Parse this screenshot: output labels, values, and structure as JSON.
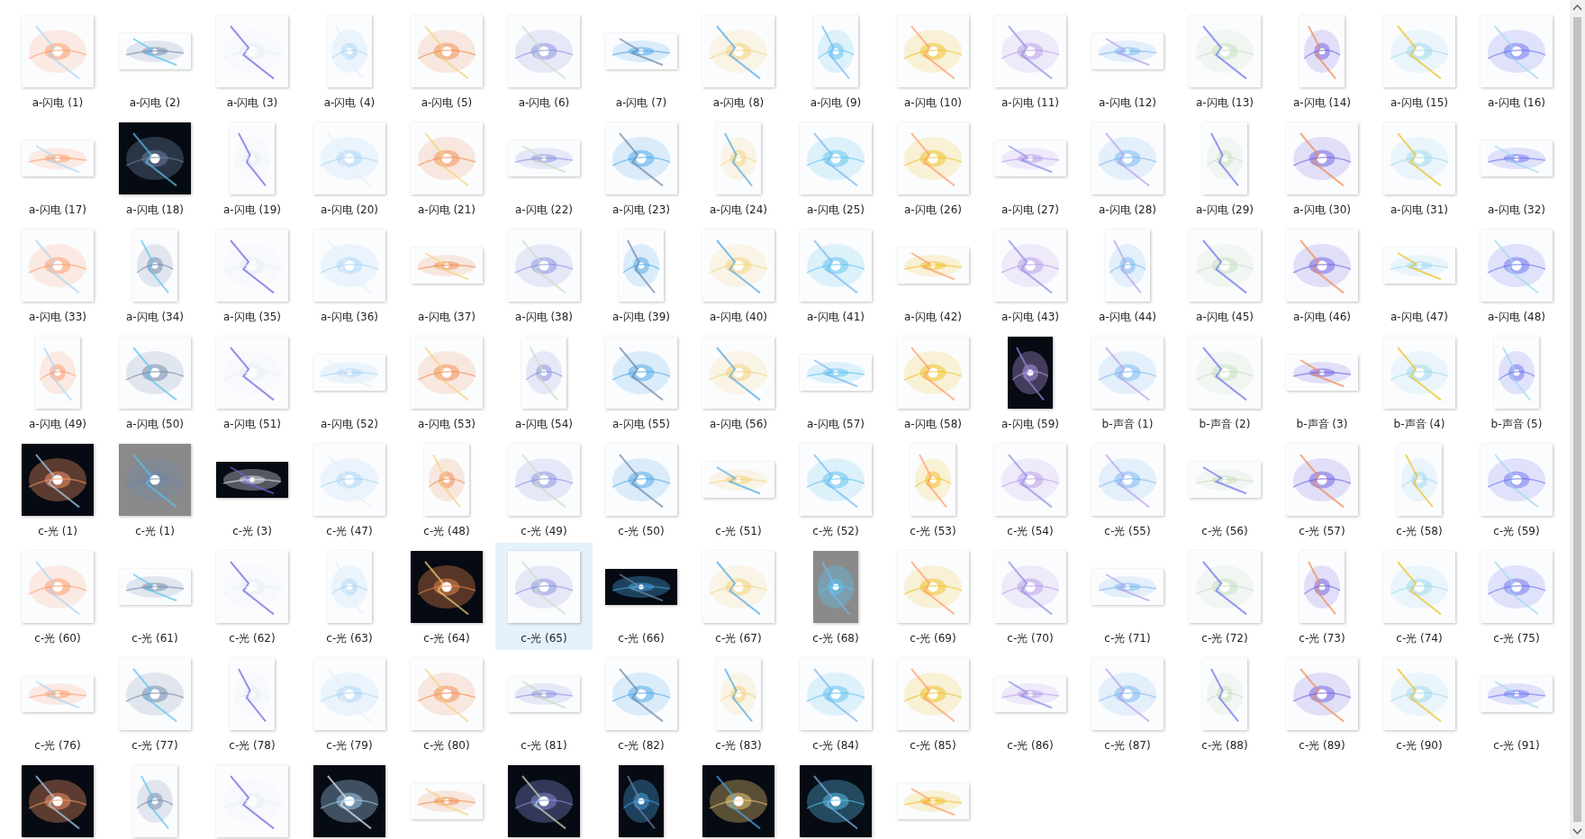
{
  "items": [
    {
      "label": "a-闪电 (1)",
      "selected": false
    },
    {
      "label": "a-闪电 (2)",
      "selected": false
    },
    {
      "label": "a-闪电 (3)",
      "selected": false
    },
    {
      "label": "a-闪电 (4)",
      "selected": false
    },
    {
      "label": "a-闪电 (5)",
      "selected": false
    },
    {
      "label": "a-闪电 (6)",
      "selected": false
    },
    {
      "label": "a-闪电 (7)",
      "selected": false
    },
    {
      "label": "a-闪电 (8)",
      "selected": false
    },
    {
      "label": "a-闪电 (9)",
      "selected": false
    },
    {
      "label": "a-闪电 (10)",
      "selected": false
    },
    {
      "label": "a-闪电 (11)",
      "selected": false
    },
    {
      "label": "a-闪电 (12)",
      "selected": false
    },
    {
      "label": "a-闪电 (13)",
      "selected": false
    },
    {
      "label": "a-闪电 (14)",
      "selected": false
    },
    {
      "label": "a-闪电 (15)",
      "selected": false
    },
    {
      "label": "a-闪电 (16)",
      "selected": false
    },
    {
      "label": "a-闪电 (17)",
      "selected": false
    },
    {
      "label": "a-闪电 (18)",
      "selected": false
    },
    {
      "label": "a-闪电 (19)",
      "selected": false
    },
    {
      "label": "a-闪电 (20)",
      "selected": false
    },
    {
      "label": "a-闪电 (21)",
      "selected": false
    },
    {
      "label": "a-闪电 (22)",
      "selected": false
    },
    {
      "label": "a-闪电 (23)",
      "selected": false
    },
    {
      "label": "a-闪电 (24)",
      "selected": false
    },
    {
      "label": "a-闪电 (25)",
      "selected": false
    },
    {
      "label": "a-闪电 (26)",
      "selected": false
    },
    {
      "label": "a-闪电 (27)",
      "selected": false
    },
    {
      "label": "a-闪电 (28)",
      "selected": false
    },
    {
      "label": "a-闪电 (29)",
      "selected": false
    },
    {
      "label": "a-闪电 (30)",
      "selected": false
    },
    {
      "label": "a-闪电 (31)",
      "selected": false
    },
    {
      "label": "a-闪电 (32)",
      "selected": false
    },
    {
      "label": "a-闪电 (33)",
      "selected": false
    },
    {
      "label": "a-闪电 (34)",
      "selected": false
    },
    {
      "label": "a-闪电 (35)",
      "selected": false
    },
    {
      "label": "a-闪电 (36)",
      "selected": false
    },
    {
      "label": "a-闪电 (37)",
      "selected": false
    },
    {
      "label": "a-闪电 (38)",
      "selected": false
    },
    {
      "label": "a-闪电 (39)",
      "selected": false
    },
    {
      "label": "a-闪电 (40)",
      "selected": false
    },
    {
      "label": "a-闪电 (41)",
      "selected": false
    },
    {
      "label": "a-闪电 (42)",
      "selected": false
    },
    {
      "label": "a-闪电 (43)",
      "selected": false
    },
    {
      "label": "a-闪电 (44)",
      "selected": false
    },
    {
      "label": "a-闪电 (45)",
      "selected": false
    },
    {
      "label": "a-闪电 (46)",
      "selected": false
    },
    {
      "label": "a-闪电 (47)",
      "selected": false
    },
    {
      "label": "a-闪电 (48)",
      "selected": false
    },
    {
      "label": "a-闪电 (49)",
      "selected": false
    },
    {
      "label": "a-闪电 (50)",
      "selected": false
    },
    {
      "label": "a-闪电 (51)",
      "selected": false
    },
    {
      "label": "a-闪电 (52)",
      "selected": false
    },
    {
      "label": "a-闪电 (53)",
      "selected": false
    },
    {
      "label": "a-闪电 (54)",
      "selected": false
    },
    {
      "label": "a-闪电 (55)",
      "selected": false
    },
    {
      "label": "a-闪电 (56)",
      "selected": false
    },
    {
      "label": "a-闪电 (57)",
      "selected": false
    },
    {
      "label": "a-闪电 (58)",
      "selected": false
    },
    {
      "label": "a-闪电 (59)",
      "selected": false
    },
    {
      "label": "b-声音 (1)",
      "selected": false
    },
    {
      "label": "b-声音 (2)",
      "selected": false
    },
    {
      "label": "b-声音 (3)",
      "selected": false
    },
    {
      "label": "b-声音 (4)",
      "selected": false
    },
    {
      "label": "b-声音 (5)",
      "selected": false
    },
    {
      "label": "c-光 (1)",
      "selected": false
    },
    {
      "label": "c-光 (1)",
      "selected": false
    },
    {
      "label": "c-光 (3)",
      "selected": false
    },
    {
      "label": "c-光 (47)",
      "selected": false
    },
    {
      "label": "c-光 (48)",
      "selected": false
    },
    {
      "label": "c-光 (49)",
      "selected": false
    },
    {
      "label": "c-光 (50)",
      "selected": false
    },
    {
      "label": "c-光 (51)",
      "selected": false
    },
    {
      "label": "c-光 (52)",
      "selected": false
    },
    {
      "label": "c-光 (53)",
      "selected": false
    },
    {
      "label": "c-光 (54)",
      "selected": false
    },
    {
      "label": "c-光 (55)",
      "selected": false
    },
    {
      "label": "c-光 (56)",
      "selected": false
    },
    {
      "label": "c-光 (57)",
      "selected": false
    },
    {
      "label": "c-光 (58)",
      "selected": false
    },
    {
      "label": "c-光 (59)",
      "selected": false
    },
    {
      "label": "c-光 (60)",
      "selected": false
    },
    {
      "label": "c-光 (61)",
      "selected": false
    },
    {
      "label": "c-光 (62)",
      "selected": false
    },
    {
      "label": "c-光 (63)",
      "selected": false
    },
    {
      "label": "c-光 (64)",
      "selected": false
    },
    {
      "label": "c-光 (65)",
      "selected": true
    },
    {
      "label": "c-光 (66)",
      "selected": false
    },
    {
      "label": "c-光 (67)",
      "selected": false
    },
    {
      "label": "c-光 (68)",
      "selected": false
    },
    {
      "label": "c-光 (69)",
      "selected": false
    },
    {
      "label": "c-光 (70)",
      "selected": false
    },
    {
      "label": "c-光 (71)",
      "selected": false
    },
    {
      "label": "c-光 (72)",
      "selected": false
    },
    {
      "label": "c-光 (73)",
      "selected": false
    },
    {
      "label": "c-光 (74)",
      "selected": false
    },
    {
      "label": "c-光 (75)",
      "selected": false
    },
    {
      "label": "c-光 (76)",
      "selected": false
    },
    {
      "label": "c-光 (77)",
      "selected": false
    },
    {
      "label": "c-光 (78)",
      "selected": false
    },
    {
      "label": "c-光 (79)",
      "selected": false
    },
    {
      "label": "c-光 (80)",
      "selected": false
    },
    {
      "label": "c-光 (81)",
      "selected": false
    },
    {
      "label": "c-光 (82)",
      "selected": false
    },
    {
      "label": "c-光 (83)",
      "selected": false
    },
    {
      "label": "c-光 (84)",
      "selected": false
    },
    {
      "label": "c-光 (85)",
      "selected": false
    },
    {
      "label": "c-光 (86)",
      "selected": false
    },
    {
      "label": "c-光 (87)",
      "selected": false
    },
    {
      "label": "c-光 (88)",
      "selected": false
    },
    {
      "label": "c-光 (89)",
      "selected": false
    },
    {
      "label": "c-光 (90)",
      "selected": false
    },
    {
      "label": "c-光 (91)",
      "selected": false
    },
    {
      "selected": false
    },
    {
      "selected": false
    },
    {
      "selected": false
    },
    {
      "selected": false
    },
    {
      "selected": false
    },
    {
      "selected": false
    },
    {
      "selected": false
    },
    {
      "selected": false
    },
    {
      "selected": false
    },
    {
      "selected": false
    }
  ]
}
